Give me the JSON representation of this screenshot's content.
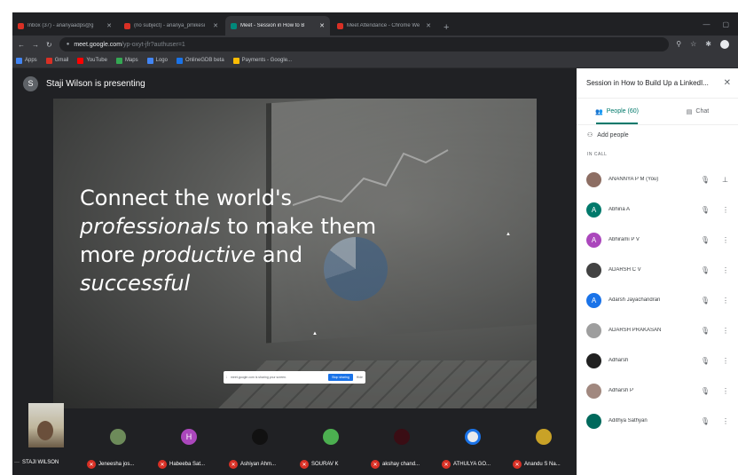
{
  "browser": {
    "tabs": [
      {
        "title": "Inbox (37) - ananyaadps@g",
        "color": "#d93025",
        "active": false
      },
      {
        "title": "(no subject) - ananya_pmikesi",
        "color": "#d93025",
        "active": false
      },
      {
        "title": "Meet - Session in How to B",
        "color": "#00897b",
        "active": true
      },
      {
        "title": "Meet Attendance - Chrome We",
        "color": "#d93025",
        "active": false
      }
    ],
    "new_tab": "+",
    "url_host": "meet.google.com",
    "url_rest": "/yp-oxyt-jfr?authuser=1",
    "bookmarks": [
      {
        "label": "Apps",
        "color": "#4285f4"
      },
      {
        "label": "Gmail",
        "color": "#d93025"
      },
      {
        "label": "YouTube",
        "color": "#ff0000"
      },
      {
        "label": "Maps",
        "color": "#34a853"
      },
      {
        "label": "Logo",
        "color": "#4285f4"
      },
      {
        "label": "OnlineGDB beta",
        "color": "#1a73e8"
      },
      {
        "label": "Payments - Google...",
        "color": "#fbbc04"
      }
    ]
  },
  "presenter": {
    "initial": "S",
    "label": "Staji Wilson is presenting"
  },
  "slide": {
    "line1": "Connect the world's",
    "line2_em": "professionals",
    "line2_rest": " to make them",
    "line3_pre": "more ",
    "line3_em": "productive",
    "line3_rest": " and",
    "line4_em": "successful",
    "share_text": "meet.google.com is sharing your screen.",
    "stop_label": "Stop sharing",
    "hide_label": "Hide"
  },
  "panel": {
    "title": "Session in How to Build Up a LinkedI...",
    "tab_people": "People (60)",
    "tab_chat": "Chat",
    "add_people": "Add people",
    "section": "IN CALL",
    "people": [
      {
        "name": "ANANNYA P M (You)",
        "initial": "",
        "color": "#8d6e63"
      },
      {
        "name": "Abhina A",
        "initial": "A",
        "color": "#00796b"
      },
      {
        "name": "Abhirami P V",
        "initial": "A",
        "color": "#ab47bc"
      },
      {
        "name": "ADARSH C V",
        "initial": "",
        "color": "#424242"
      },
      {
        "name": "Adarsh Jayachandran",
        "initial": "A",
        "color": "#1a73e8"
      },
      {
        "name": "ADARSH PRAKASAN",
        "initial": "",
        "color": "#9e9e9e"
      },
      {
        "name": "Adharsh",
        "initial": "",
        "color": "#212121"
      },
      {
        "name": "Adharsh P",
        "initial": "",
        "color": "#a1887f"
      },
      {
        "name": "Adithya Sathyan",
        "initial": "",
        "color": "#00695c"
      }
    ]
  },
  "strip": {
    "self_label": "STAJI WILSON",
    "tiles": [
      {
        "name": "Jeneesha jos...",
        "initial": "",
        "color": "#6d8b5a"
      },
      {
        "name": "Habeeba Sat...",
        "initial": "H",
        "color": "#ab47bc"
      },
      {
        "name": "Ashiyan Ahm...",
        "initial": "",
        "color": "#111111"
      },
      {
        "name": "SOURAV K",
        "initial": "",
        "color": "#4caf50"
      },
      {
        "name": "akshay chand...",
        "initial": "",
        "color": "#3a0d14"
      },
      {
        "name": "ATHULYA GO...",
        "initial": "",
        "color": "#e8eaed"
      },
      {
        "name": "Anandu S Na...",
        "initial": "",
        "color": "#c9a227"
      }
    ]
  }
}
